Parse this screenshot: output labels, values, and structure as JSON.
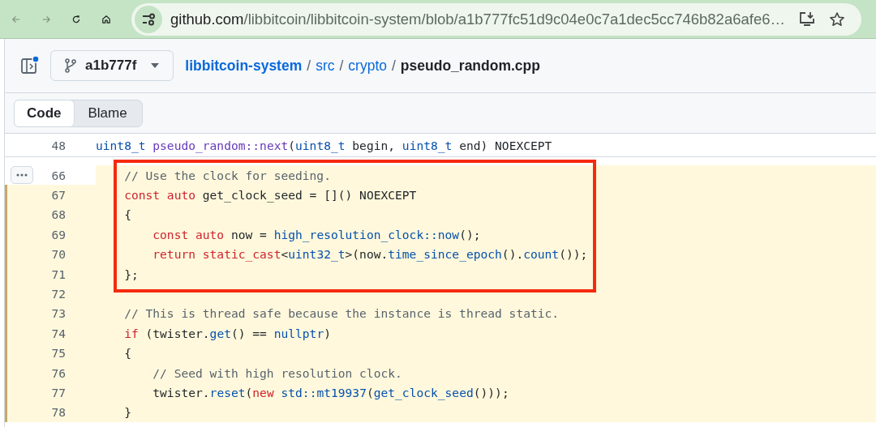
{
  "browser": {
    "back": {
      "disabled": true
    },
    "forward": {
      "disabled": true
    },
    "url_host": "github.com",
    "url_path": "/libbitcoin/libbitcoin-system/blob/a1b777fc51d9c04e0c7a1dec5cc746b82a6afe6…"
  },
  "header": {
    "branch": "a1b777f",
    "notification": true,
    "breadcrumb": [
      {
        "text": "libbitcoin-system",
        "kind": "repo"
      },
      {
        "text": "/",
        "kind": "sep"
      },
      {
        "text": "src",
        "kind": "dir"
      },
      {
        "text": "/",
        "kind": "sep"
      },
      {
        "text": "crypto",
        "kind": "dir"
      },
      {
        "text": "/",
        "kind": "sep"
      },
      {
        "text": "pseudo_random.cpp",
        "kind": "file"
      }
    ]
  },
  "tabs": [
    {
      "label": "Code",
      "selected": true
    },
    {
      "label": "Blame",
      "selected": false
    }
  ],
  "sticky_line": {
    "number": "48",
    "tokens": [
      {
        "kind": "type",
        "text": "uint8_t "
      },
      {
        "kind": "ent",
        "text": "pseudo_random::next"
      },
      {
        "kind": "pl",
        "text": "("
      },
      {
        "kind": "type",
        "text": "uint8_t"
      },
      {
        "kind": "pl",
        "text": " begin, "
      },
      {
        "kind": "type",
        "text": "uint8_t"
      },
      {
        "kind": "pl",
        "text": " end) NOEXCEPT"
      }
    ]
  },
  "framed_lines": [
    {
      "number": "66",
      "kind": "expandable",
      "tokens": [
        {
          "kind": "cm",
          "text": "    // Use the clock for seeding."
        }
      ]
    },
    {
      "number": "67",
      "kind": "plain",
      "tokens": [
        {
          "kind": "kw",
          "text": "    const auto"
        },
        {
          "kind": "pl",
          "text": " get_clock_seed = []() NOEXCEPT"
        }
      ]
    },
    {
      "number": "68",
      "kind": "plain",
      "tokens": [
        {
          "kind": "pl",
          "text": "    {"
        }
      ]
    },
    {
      "number": "69",
      "kind": "plain",
      "tokens": [
        {
          "kind": "kw",
          "text": "        const auto"
        },
        {
          "kind": "pl",
          "text": " now = "
        },
        {
          "kind": "type",
          "text": "high_resolution_clock::now"
        },
        {
          "kind": "pl",
          "text": "();"
        }
      ]
    },
    {
      "number": "70",
      "kind": "plain",
      "tokens": [
        {
          "kind": "kw",
          "text": "        return static_cast"
        },
        {
          "kind": "pl",
          "text": "<"
        },
        {
          "kind": "type",
          "text": "uint32_t"
        },
        {
          "kind": "pl",
          "text": ">(now."
        },
        {
          "kind": "type",
          "text": "time_since_epoch"
        },
        {
          "kind": "pl",
          "text": "()."
        },
        {
          "kind": "type",
          "text": "count"
        },
        {
          "kind": "pl",
          "text": "());"
        }
      ]
    },
    {
      "number": "71",
      "kind": "plain",
      "tokens": [
        {
          "kind": "pl",
          "text": "    };"
        }
      ]
    }
  ],
  "lines": [
    {
      "number": "72",
      "kind": "plain"
    },
    {
      "number": "73",
      "kind": "plain",
      "tokens": [
        {
          "kind": "cm",
          "text": "    // This is thread safe because the instance is thread static."
        }
      ]
    },
    {
      "number": "74",
      "kind": "plain",
      "tokens": [
        {
          "kind": "kw",
          "text": "    if"
        },
        {
          "kind": "pl",
          "text": " (twister."
        },
        {
          "kind": "type",
          "text": "get"
        },
        {
          "kind": "pl",
          "text": "() == "
        },
        {
          "kind": "type",
          "text": "nullptr"
        },
        {
          "kind": "pl",
          "text": ")"
        }
      ]
    },
    {
      "number": "75",
      "kind": "plain",
      "tokens": [
        {
          "kind": "pl",
          "text": "    {"
        }
      ]
    },
    {
      "number": "76",
      "kind": "plain",
      "tokens": [
        {
          "kind": "cm",
          "text": "        // Seed with high resolution clock."
        }
      ]
    },
    {
      "number": "77",
      "kind": "plain",
      "tokens": [
        {
          "kind": "pl",
          "text": "        twister."
        },
        {
          "kind": "type",
          "text": "reset"
        },
        {
          "kind": "pl",
          "text": "("
        },
        {
          "kind": "kw",
          "text": "new "
        },
        {
          "kind": "type",
          "text": "std::mt19937"
        },
        {
          "kind": "pl",
          "text": "("
        },
        {
          "kind": "type",
          "text": "get_clock_seed"
        },
        {
          "kind": "pl",
          "text": "()));"
        }
      ]
    },
    {
      "number": "78",
      "kind": "plain",
      "tokens": [
        {
          "kind": "pl",
          "text": "    }"
        }
      ]
    }
  ]
}
